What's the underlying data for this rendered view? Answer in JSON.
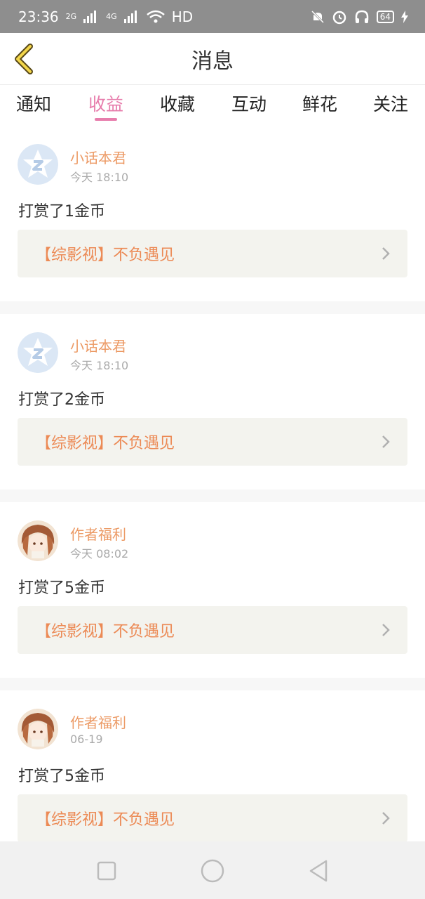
{
  "status_bar": {
    "time": "23:36",
    "network_a": "2G",
    "network_b": "4G",
    "hd": "HD",
    "battery": "64"
  },
  "header": {
    "title": "消息"
  },
  "tabs": [
    {
      "label": "通知"
    },
    {
      "label": "收益"
    },
    {
      "label": "收藏"
    },
    {
      "label": "互动"
    },
    {
      "label": "鲜花"
    },
    {
      "label": "关注"
    }
  ],
  "active_tab": "收益",
  "colors": {
    "accent": "#e77dac",
    "name": "#ec9a65",
    "book": "#ec8a55"
  },
  "messages": [
    {
      "sender": "小话本君",
      "time": "今天 18:10",
      "text": "打赏了1金币",
      "book": "【综影视】不负遇见",
      "avatar": "star-logo"
    },
    {
      "sender": "小话本君",
      "time": "今天 18:10",
      "text": "打赏了2金币",
      "book": "【综影视】不负遇见",
      "avatar": "star-logo"
    },
    {
      "sender": "作者福利",
      "time": "今天 08:02",
      "text": "打赏了5金币",
      "book": "【综影视】不负遇见",
      "avatar": "anime-girl"
    },
    {
      "sender": "作者福利",
      "time": "06-19",
      "text": "打赏了5金币",
      "book": "【综影视】不负遇见",
      "avatar": "anime-girl"
    }
  ]
}
